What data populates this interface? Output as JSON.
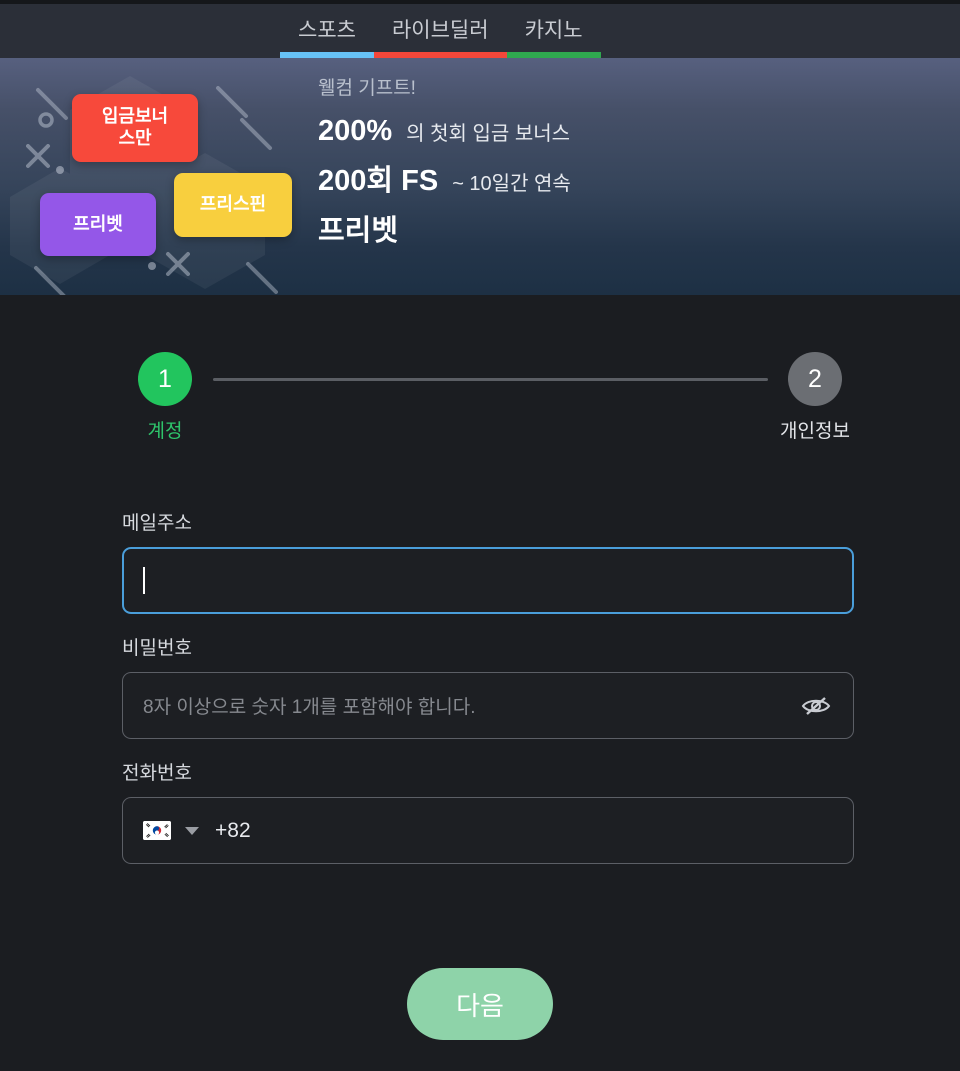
{
  "tabs": [
    {
      "label": "스포츠",
      "underline_color": "#67c2f5",
      "name": "tab-sports"
    },
    {
      "label": "라이브딜러",
      "underline_color": "#f4473a",
      "name": "tab-live-dealer"
    },
    {
      "label": "카지노",
      "underline_color": "#2fa84f",
      "name": "tab-casino"
    }
  ],
  "banner": {
    "kicker": "웰컴 기프트!",
    "line1_strong": "200%",
    "line1_rest": "의 첫회 입금 보너스",
    "line2_strong": "200회 FS",
    "line2_rest": "~ 10일간 연속",
    "line3": "프리벳",
    "badges": [
      {
        "text": "입금보너\n스만",
        "color": "#f7493b",
        "name": "badge-deposit-bonus"
      },
      {
        "text": "프리스핀",
        "color": "#f8cf3e",
        "name": "badge-free-spin"
      },
      {
        "text": "프리벳",
        "color": "#9457e8",
        "name": "badge-free-bet"
      }
    ]
  },
  "stepper": {
    "steps": [
      {
        "number": "1",
        "label": "계정",
        "state": "active"
      },
      {
        "number": "2",
        "label": "개인정보",
        "state": "inactive"
      }
    ],
    "active_color": "#22c55e",
    "inactive_color": "#6b6e73"
  },
  "form": {
    "email": {
      "label": "메일주소",
      "value": "",
      "placeholder": "",
      "focused": true
    },
    "password": {
      "label": "비밀번호",
      "value": "",
      "placeholder": "8자 이상으로 숫자 1개를 포함해야 합니다.",
      "toggle_icon": "eye-off-icon"
    },
    "phone": {
      "label": "전화번호",
      "country_flag": "kr-flag-icon",
      "dial_code": "+82",
      "value": "",
      "dropdown_icon": "chevron-down-icon"
    }
  },
  "submit": {
    "label": "다음",
    "color": "#8ed3a9"
  }
}
